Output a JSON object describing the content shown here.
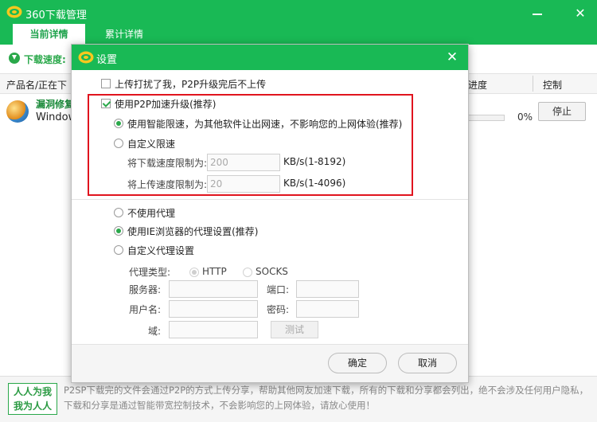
{
  "app": {
    "title": "360下载管理",
    "minimize_glyph": "",
    "close_glyph": "✕",
    "tabs": [
      {
        "label": "当前详情",
        "active": true
      },
      {
        "label": "累计详情",
        "active": false
      }
    ]
  },
  "speed": {
    "label": "下载速度:"
  },
  "table": {
    "columns": {
      "name": "产品名/正在下",
      "progress": "进度",
      "control": "控制"
    },
    "rows": [
      {
        "title": "漏洞修复",
        "subtitle": "Window",
        "progress_pct": "0%",
        "progress_value": 0,
        "action": "停止"
      }
    ]
  },
  "footer": {
    "badge_line1": "人人为我",
    "badge_line2": "我为人人",
    "text": "P2SP下载完的文件会通过P2P的方式上传分享，帮助其他网友加速下载，所有的下载和分享都会列出，绝不会涉及任何用户隐私，下载和分享是通过智能带宽控制技术，不会影响您的上网体验，请放心使用！"
  },
  "dialog": {
    "title": "设置",
    "close_glyph": "✕",
    "upload_disturb": {
      "label": "上传打扰了我，P2P升级完后不上传",
      "checked": false
    },
    "p2p_upgrade": {
      "label": "使用P2P加速升级(推荐)",
      "checked": true
    },
    "smart_limit": {
      "label": "使用智能限速，为其他软件让出网速，不影响您的上网体验(推荐)",
      "checked": true
    },
    "custom_limit": {
      "label": "自定义限速",
      "checked": false
    },
    "download_limit": {
      "label": "将下载速度限制为:",
      "value": "200",
      "unit": "KB/s(1-8192)"
    },
    "upload_limit": {
      "label": "将上传速度限制为:",
      "value": "20",
      "unit": "KB/s(1-4096)"
    },
    "proxy": {
      "none": {
        "label": "不使用代理",
        "checked": false
      },
      "ie": {
        "label": "使用IE浏览器的代理设置(推荐)",
        "checked": true
      },
      "custom": {
        "label": "自定义代理设置",
        "checked": false
      },
      "type_label": "代理类型:",
      "http": {
        "label": "HTTP",
        "checked": true
      },
      "socks": {
        "label": "SOCKS",
        "checked": false
      },
      "server_label": "服务器:",
      "port_label": "端口:",
      "username_label": "用户名:",
      "password_label": "密码:",
      "domain_label": "域:",
      "test_label": "测试"
    },
    "ok_label": "确定",
    "cancel_label": "取消"
  },
  "colors": {
    "brand_green": "#19b955",
    "accent_green": "#2aa84a",
    "highlight_red": "#e0141e"
  }
}
